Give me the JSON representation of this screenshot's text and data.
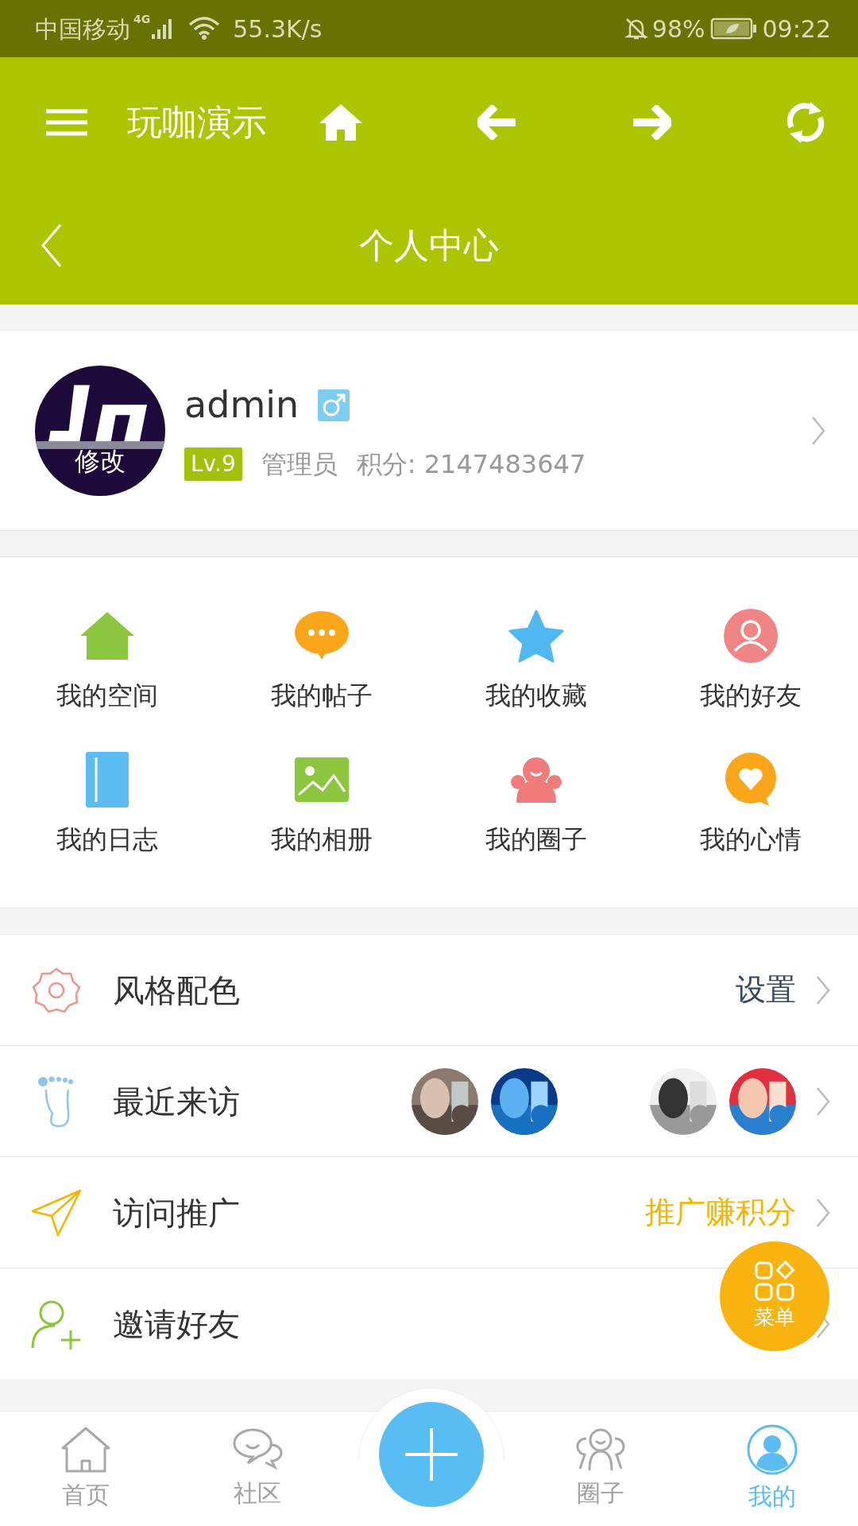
{
  "status_bar": {
    "carrier": "中国移动",
    "network": "4G",
    "speed": "55.3K/s",
    "battery": "98%",
    "time": "09:22"
  },
  "toolbar": {
    "title": "玩咖演示"
  },
  "header": {
    "title": "个人中心"
  },
  "profile": {
    "avatar_label": "修改",
    "name": "admin",
    "level": "Lv.9",
    "role": "管理员",
    "points": "积分: 2147483647"
  },
  "grid": [
    {
      "label": "我的空间",
      "color": "#8cc63f"
    },
    {
      "label": "我的帖子",
      "color": "#f9a61a"
    },
    {
      "label": "我的收藏",
      "color": "#4fb8f0"
    },
    {
      "label": "我的好友",
      "color": "#f08585"
    },
    {
      "label": "我的日志",
      "color": "#5bbcf2"
    },
    {
      "label": "我的相册",
      "color": "#8cc63f"
    },
    {
      "label": "我的圈子",
      "color": "#f07b7b"
    },
    {
      "label": "我的心情",
      "color": "#f9a61a"
    }
  ],
  "rows": [
    {
      "kind": "value",
      "label": "风格配色",
      "value": "设置",
      "accent": false
    },
    {
      "kind": "visitors",
      "label": "最近来访"
    },
    {
      "kind": "value",
      "label": "访问推广",
      "value": "推广赚积分",
      "accent": true
    },
    {
      "kind": "plain",
      "label": "邀请好友"
    }
  ],
  "fab": {
    "label": "菜单"
  },
  "nav": [
    {
      "kind": "tab",
      "label": "首页",
      "selected": false
    },
    {
      "kind": "tab",
      "label": "社区",
      "selected": false
    },
    {
      "kind": "plus"
    },
    {
      "kind": "tab",
      "label": "圈子",
      "selected": false
    },
    {
      "kind": "tab",
      "label": "我的",
      "selected": true
    }
  ]
}
